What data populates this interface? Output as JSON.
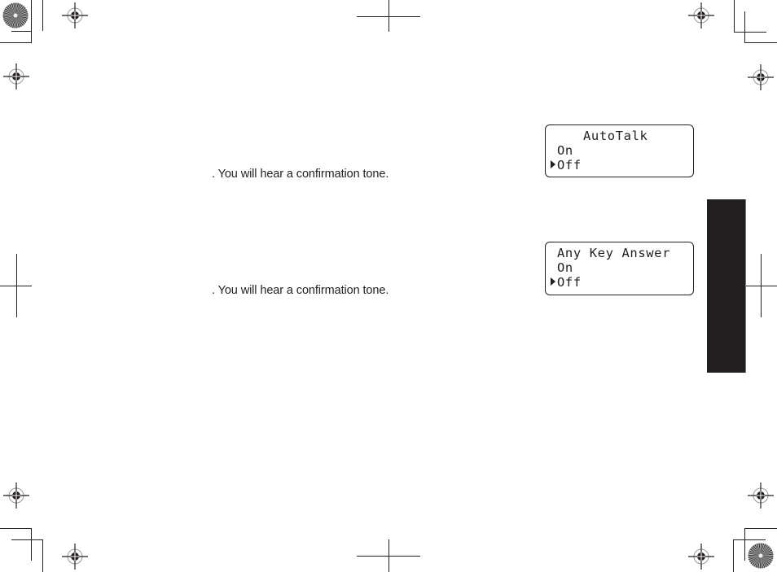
{
  "page": {
    "body_lines": [
      {
        "text": ". You will hear a confirmation tone."
      },
      {
        "text": ". You will hear a confirmation tone."
      }
    ],
    "lcd_screens": [
      {
        "title": "AutoTalk",
        "options": [
          {
            "label": "On",
            "selected": false
          },
          {
            "label": "Off",
            "selected": true
          }
        ],
        "cursor_icon": "triangle-right-cursor"
      },
      {
        "title": "Any Key Answer",
        "options": [
          {
            "label": "On",
            "selected": false
          },
          {
            "label": "Off",
            "selected": true
          }
        ],
        "cursor_icon": "triangle-right-cursor"
      }
    ],
    "side_tab": {
      "color": "#231f20",
      "label": ""
    },
    "print_marks": {
      "ink_color": "#231f20",
      "registration_targets": 8,
      "color_wheels": 2,
      "crop_mark_sets": 4
    }
  }
}
